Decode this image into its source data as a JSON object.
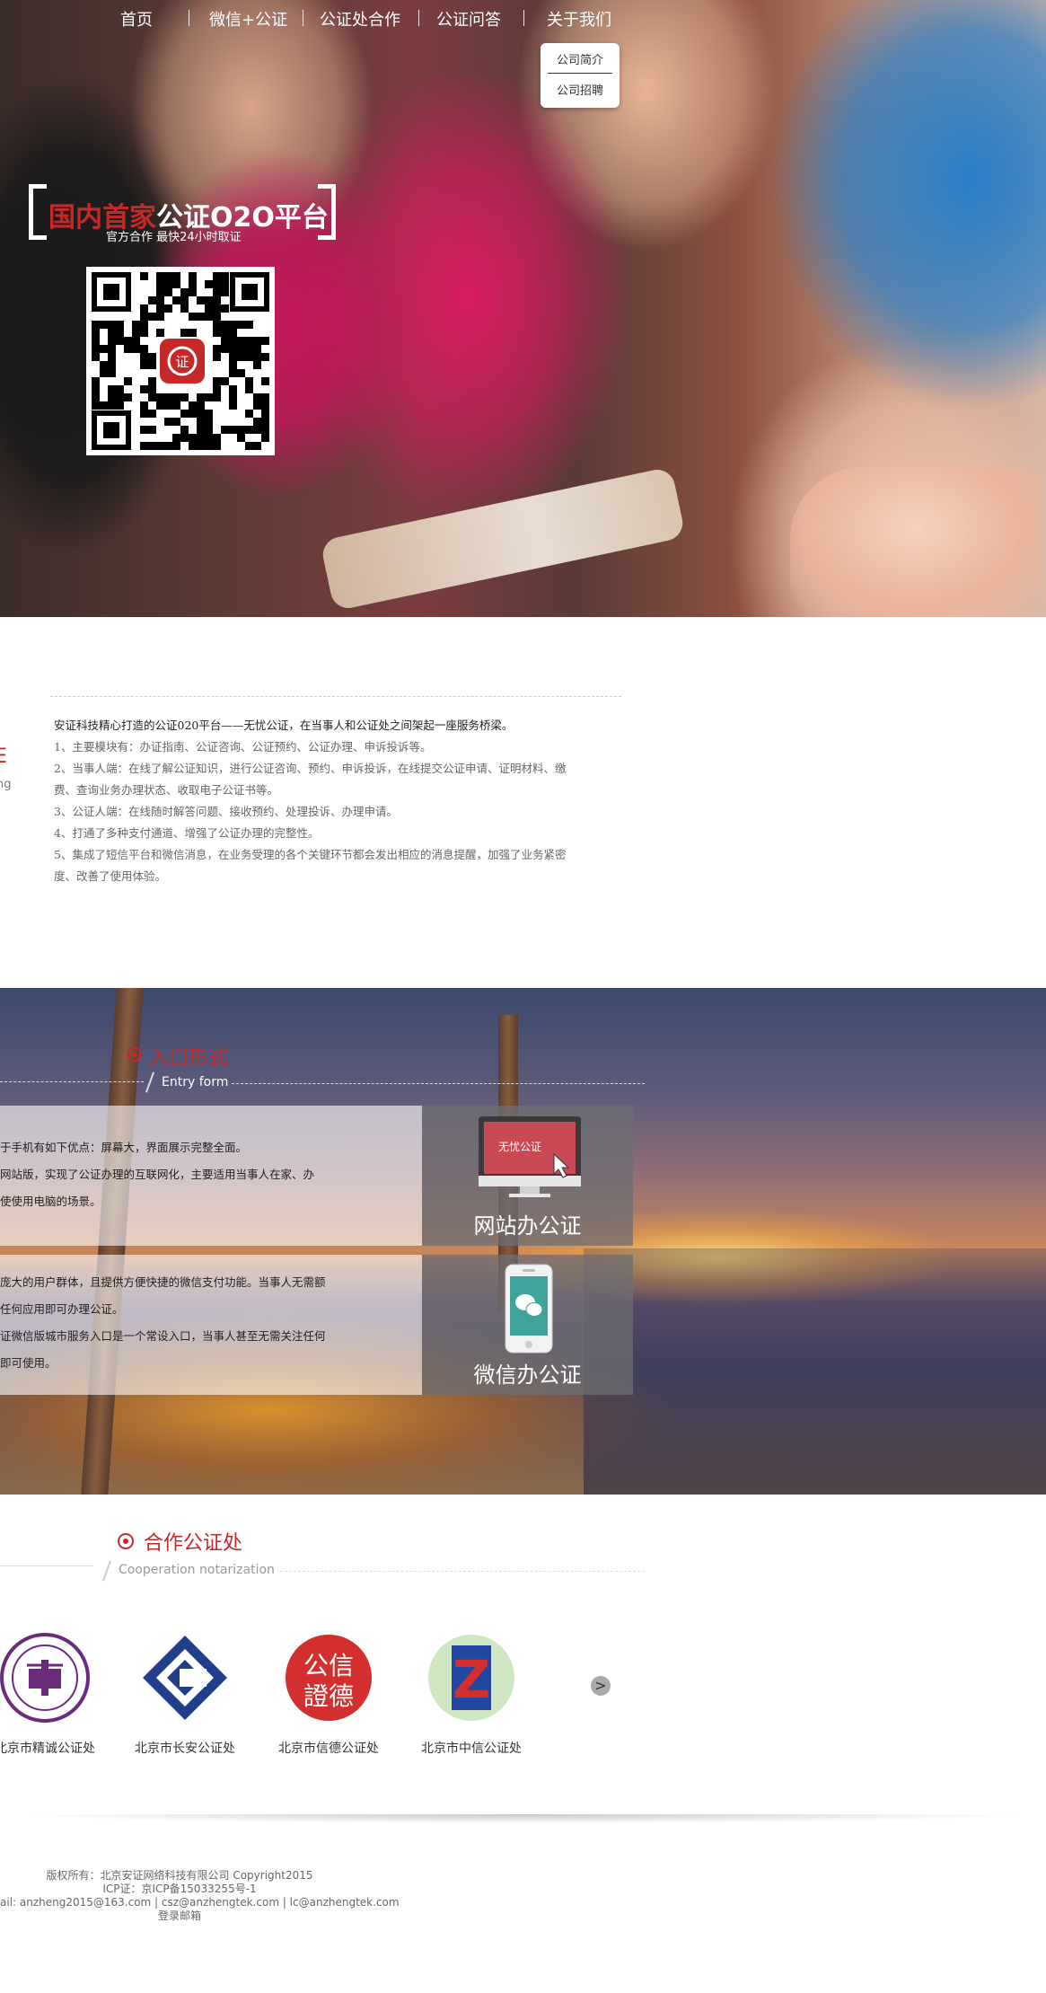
{
  "nav": {
    "items": [
      "首页",
      "微信+公证",
      "公证处合作",
      "公证问答",
      "关于我们"
    ],
    "dropdown": [
      "公司简介",
      "公司招聘"
    ]
  },
  "hero": {
    "title_red": "国内首家",
    "title_white": "公证O2O平台",
    "subtitle": "官方合作  最快24小时取证",
    "qr_icon": "qr-code-with-seal-logo"
  },
  "intro": {
    "left_fragment_title": "E",
    "left_fragment_sub": "ng",
    "lead": "安证科技精心打造的公证020平台——无忧公证，在当事人和公证处之间架起一座服务桥梁。",
    "points": [
      "1、主要模块有：办证指南、公证咨询、公证预约、公证办理、申诉投诉等。",
      "2、当事人端：在线了解公证知识，进行公证咨询、预约、申诉投诉，在线提交公证申请、证明材料、缴",
      "费、查询业务办理状态、收取电子公证书等。",
      "3、公证人端：在线随时解答问题、接收预约、处理投诉、办理申请。",
      "4、打通了多种支付通道、增强了公证办理的完整性。",
      "5、集成了短信平台和微信消息，在业务受理的各个关键环节都会发出相应的消息提醒，加强了业务紧密",
      "度、改善了使用体验。"
    ]
  },
  "entry": {
    "title": "入口形式",
    "subtitle": "Entry form",
    "cards": [
      {
        "lines": [
          "于手机有如下优点：屏幕大，界面展示完整全面。",
          "网站版，实现了公证办理的互联网化，主要适用当事人在家、办",
          "使使用电脑的场景。"
        ],
        "button_label": "网站办公证",
        "screen_text": "无忧公证",
        "icon": "monitor-icon"
      },
      {
        "lines": [
          "庞大的用户群体，且提供方便快捷的微信支付功能。当事人无需额",
          "任何应用即可办理公证。",
          "证微信版城市服务入口是一个常设入口，当事人甚至无需关注任何",
          "即可使用。"
        ],
        "button_label": "微信办公证",
        "icon": "wechat-phone-icon"
      }
    ]
  },
  "coop": {
    "title": "合作公证处",
    "subtitle": "Cooperation notarization",
    "partners": [
      {
        "name": "北京市精诚公证处",
        "logo_color": "#6a2c7a"
      },
      {
        "name": "北京市长安公证处",
        "logo_color": "#1f3f8a"
      },
      {
        "name": "北京市信德公证处",
        "logo_color": "#d32f2f",
        "logo_text": [
          "公信",
          "證德"
        ]
      },
      {
        "name": "北京市中信公证处",
        "logo_color": "#d32f2f",
        "logo_text": [
          "Z"
        ]
      }
    ],
    "next_symbol": ">"
  },
  "footer": {
    "lines": [
      "版权所有：北京安证网络科技有限公司 Copyright2015",
      "ICP证：京ICP备15033255号-1",
      "ail: anzheng2015@163.com | csz@anzhengtek.com | lc@anzhengtek.com",
      "登录邮箱"
    ]
  },
  "colors": {
    "accent": "#c62828",
    "text": "#444444"
  }
}
